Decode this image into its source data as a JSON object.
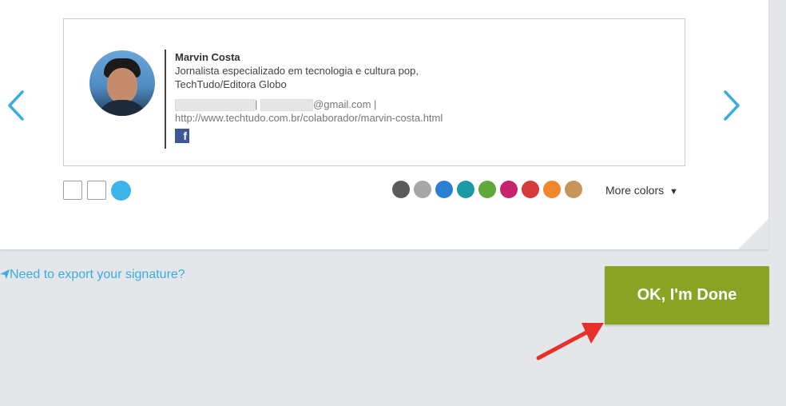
{
  "signature": {
    "name": "Marvin Costa",
    "title_line1": "Jornalista especializado em tecnologia e cultura pop,",
    "title_line2": "TechTudo/Editora Globo",
    "separator": "|",
    "email_suffix": "@gmail.com |",
    "website": "http://www.techtudo.com.br/colaborador/marvin-costa.html",
    "social_icon": "facebook-icon",
    "fb_glyph": "f"
  },
  "palette": {
    "colors": [
      "#5b5b5b",
      "#a6a6a6",
      "#2a7fd4",
      "#1b9aa6",
      "#5fa83a",
      "#c8236e",
      "#d63a3a",
      "#f0872a",
      "#c9945a"
    ],
    "more_label": "More colors",
    "dropdown_icon": "triangle-down-icon"
  },
  "layouts": {
    "selected_color": "#3cb6ea"
  },
  "footer": {
    "export_label": "Need to export your signature?",
    "done_label": "OK, I'm Done",
    "done_color": "#8ba325"
  },
  "nav": {
    "prev_icon": "chevron-left-icon",
    "next_icon": "chevron-right-icon"
  }
}
